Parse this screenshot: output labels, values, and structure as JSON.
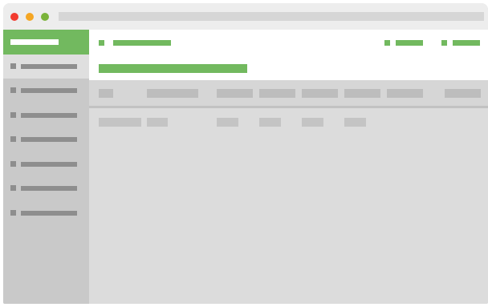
{
  "colors": {
    "accent": "#72b95f",
    "close": "#f23b2f",
    "minimize": "#f5a623",
    "maximize": "#7ab33a",
    "sidebar": "#c9c9c9",
    "content": "#dcdcdc"
  },
  "window": {
    "controls": [
      "close",
      "minimize",
      "maximize"
    ]
  },
  "sidebar": {
    "header_icon": "placeholder-bar",
    "items": [
      {
        "icon": "square-icon",
        "active": true
      },
      {
        "icon": "square-icon",
        "active": false
      },
      {
        "icon": "square-icon",
        "active": false
      },
      {
        "icon": "square-icon",
        "active": false
      },
      {
        "icon": "square-icon",
        "active": false
      },
      {
        "icon": "square-icon",
        "active": false
      },
      {
        "icon": "square-icon",
        "active": false
      }
    ]
  },
  "table": {
    "column_count": 8,
    "row_count": 1
  }
}
